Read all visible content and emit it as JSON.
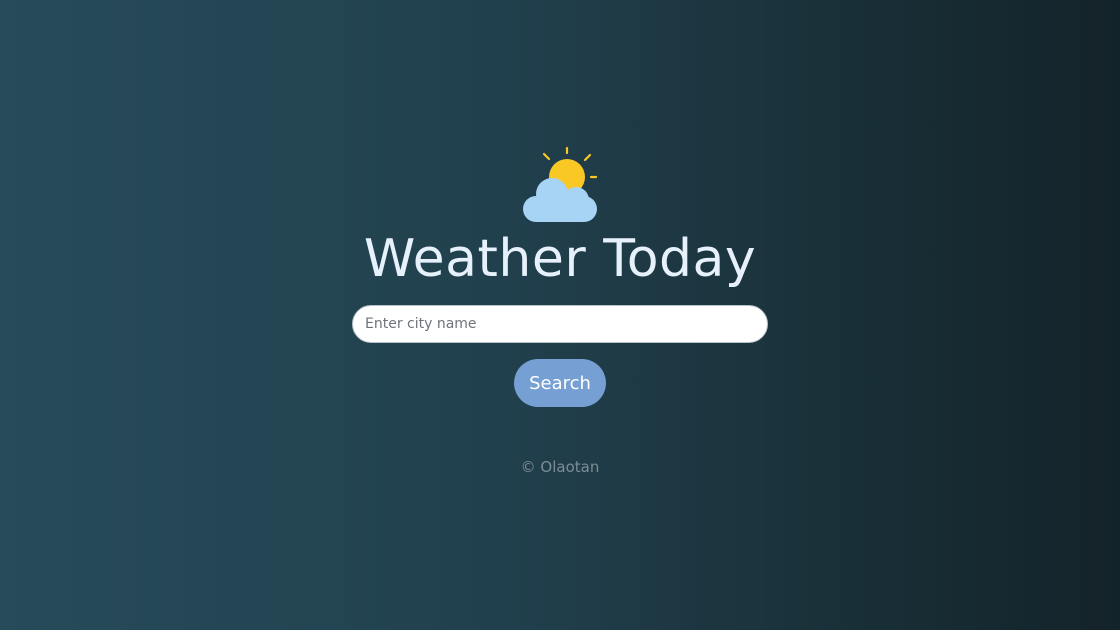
{
  "app": {
    "logo_icon": "sun-behind-cloud-icon",
    "title": "Weather Today"
  },
  "search": {
    "placeholder": "Enter city name",
    "value": "",
    "button_label": "Search"
  },
  "footer": {
    "text": "© Olaotan"
  },
  "colors": {
    "title": "#e6f1fb",
    "button": "#76a0d4",
    "sun": "#f9c825",
    "cloud": "#a7d3f5",
    "footer_text": "#7c8d95"
  }
}
